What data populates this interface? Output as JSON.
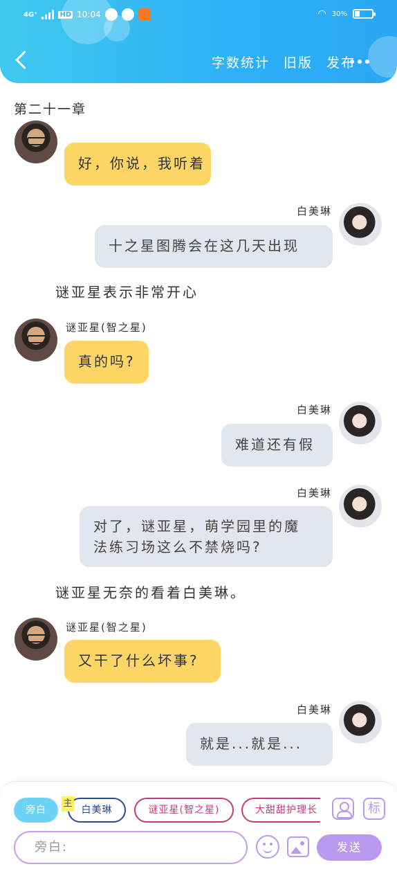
{
  "status_bar": {
    "network": "4G⁺",
    "hd": "HD",
    "time": "10:04",
    "battery": "30%",
    "battery_level": 0.3
  },
  "header": {
    "links": {
      "word_count": "字数统计",
      "old_version": "旧版",
      "publish": "发布"
    }
  },
  "chapter_title": "第二十一章",
  "messages": {
    "m1": {
      "text": "好，你说，我听着"
    },
    "m2": {
      "name": "白美琳",
      "text": "十之星图腾会在这几天出现"
    },
    "n1": {
      "text": "谜亚星表示非常开心"
    },
    "m3": {
      "name": "谜亚星(智之星)",
      "text": "真的吗?"
    },
    "m4": {
      "name": "白美琳",
      "text": "难道还有假"
    },
    "m5": {
      "name": "白美琳",
      "line1": "对了，谜亚星，萌学园里的魔",
      "line2": "法练习场这么不禁烧吗?"
    },
    "n2": {
      "text": "谜亚星无奈的看着白美琳。"
    },
    "m6": {
      "name": "谜亚星(智之星)",
      "text": "又干了什么坏事?"
    },
    "m7": {
      "name": "白美琳",
      "text": "就是...就是..."
    }
  },
  "composer": {
    "roles": {
      "narrator": "旁白",
      "main_tag": "主",
      "baimeilin": "白美琳",
      "miyaxing": "谜亚星(智之星)",
      "sweet": "大甜甜护理长"
    },
    "mark_btn": "标",
    "input_value": "旁白:",
    "send": "发送"
  }
}
